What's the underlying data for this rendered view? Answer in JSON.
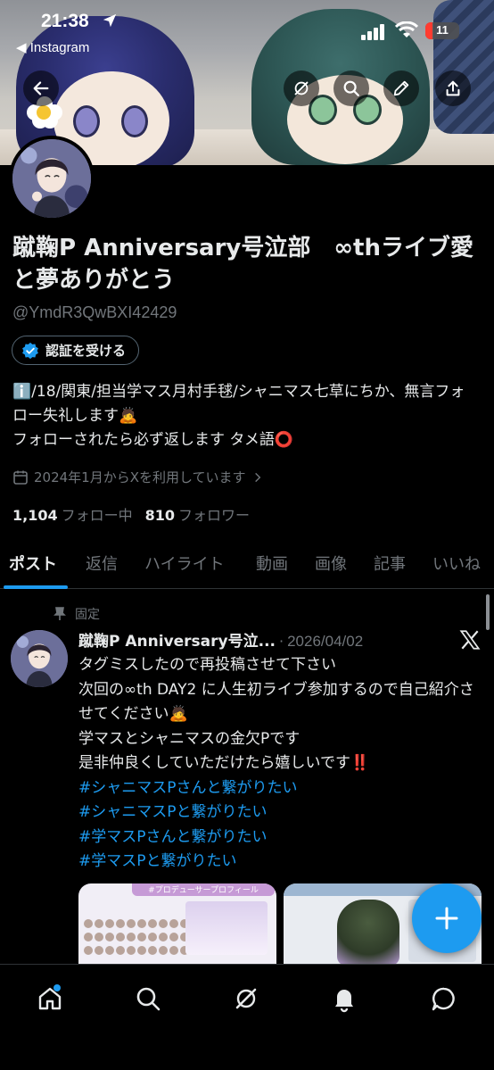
{
  "status_bar": {
    "time": "21:38",
    "back_app": "◀ Instagram",
    "battery_level": "11"
  },
  "profile": {
    "display_name": "蹴鞠P Anniversary号泣部　∞thライブ愛と夢ありがとう",
    "handle": "@YmdR3QwBXI42429",
    "verify_label": "認証を受ける",
    "bio_lines": [
      "ℹ️/18/関東/担当学マス月村手毬/シャニマス七草にちか、無言フォロー失礼します🙇",
      "フォローされたら必ず返します タメ語⭕"
    ],
    "joined": "2024年1月からXを利用しています",
    "following_count": "1,104",
    "following_label": "フォロー中",
    "followers_count": "810",
    "followers_label": "フォロワー"
  },
  "tabs": [
    {
      "label": "ポスト",
      "active": true
    },
    {
      "label": "返信",
      "active": false
    },
    {
      "label": "ハイライト",
      "active": false
    },
    {
      "label": "動画",
      "active": false
    },
    {
      "label": "画像",
      "active": false
    },
    {
      "label": "記事",
      "active": false
    },
    {
      "label": "いいね",
      "active": false
    }
  ],
  "post": {
    "pinned_label": "固定",
    "author": "蹴鞠P Anniversary号泣...",
    "separator": "·",
    "date": "2026/04/02",
    "body_lines": [
      "タグミスしたので再投稿させて下さい",
      "次回の∞th DAY2 に人生初ライブ参加するので自己紹介させてください🙇",
      "学マスとシャニマスの金欠Pです",
      "是非仲良くしていただけたら嬉しいです‼️"
    ],
    "hashtags": [
      "#シャニマスPさんと繋がりたい",
      "#シャニマスPと繋がりたい",
      "#学マスPさんと繋がりたい",
      "#学マスPと繋がりたい"
    ],
    "media1_header": "#プロデューサープロフィール"
  },
  "colors": {
    "accent": "#1d9bf0",
    "background": "#000000",
    "text": "#e7e9ea",
    "muted": "#71767b"
  },
  "icons": {
    "back": "arrow-left-icon",
    "grok": "grok-icon",
    "search": "search-icon",
    "edit": "pencil-icon",
    "share": "share-icon",
    "home": "home-icon",
    "notifications": "bell-icon",
    "messages": "chat-icon"
  }
}
